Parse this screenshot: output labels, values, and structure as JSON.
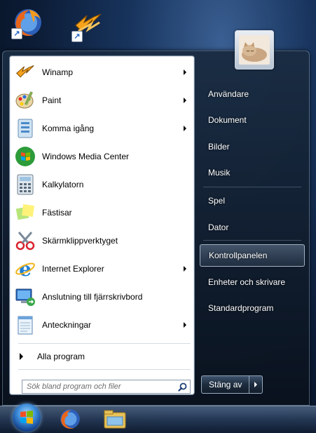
{
  "desktop": {
    "icons": [
      {
        "name": "firefox"
      },
      {
        "name": "winamp"
      }
    ]
  },
  "start_menu": {
    "programs": [
      {
        "label": "Winamp",
        "icon": "winamp-icon",
        "submenu": true
      },
      {
        "label": "Paint",
        "icon": "paint-icon",
        "submenu": true
      },
      {
        "label": "Komma igång",
        "icon": "getting-started-icon",
        "submenu": true
      },
      {
        "label": "Windows Media Center",
        "icon": "media-center-icon",
        "submenu": false
      },
      {
        "label": "Kalkylatorn",
        "icon": "calculator-icon",
        "submenu": false
      },
      {
        "label": "Fästisar",
        "icon": "sticky-notes-icon",
        "submenu": false
      },
      {
        "label": "Skärmklippverktyget",
        "icon": "snipping-tool-icon",
        "submenu": false
      },
      {
        "label": "Internet Explorer",
        "icon": "internet-explorer-icon",
        "submenu": true
      },
      {
        "label": "Anslutning till fjärrskrivbord",
        "icon": "remote-desktop-icon",
        "submenu": false
      },
      {
        "label": "Anteckningar",
        "icon": "notepad-icon",
        "submenu": true
      }
    ],
    "all_programs_label": "Alla program",
    "search_placeholder": "Sök bland program och filer",
    "right_items": [
      {
        "label": "Användare"
      },
      {
        "label": "Dokument"
      },
      {
        "label": "Bilder"
      },
      {
        "label": "Musik"
      },
      {
        "label": "Spel"
      },
      {
        "label": "Dator"
      },
      {
        "label": "Kontrollpanelen",
        "highlighted": true
      },
      {
        "label": "Enheter och skrivare"
      },
      {
        "label": "Standardprogram"
      }
    ],
    "shutdown_label": "Stäng av"
  },
  "taskbar": {
    "pinned": [
      "firefox-icon",
      "explorer-icon"
    ]
  },
  "colors": {
    "highlight": "#5a6f88",
    "accent": "#2566c7"
  }
}
